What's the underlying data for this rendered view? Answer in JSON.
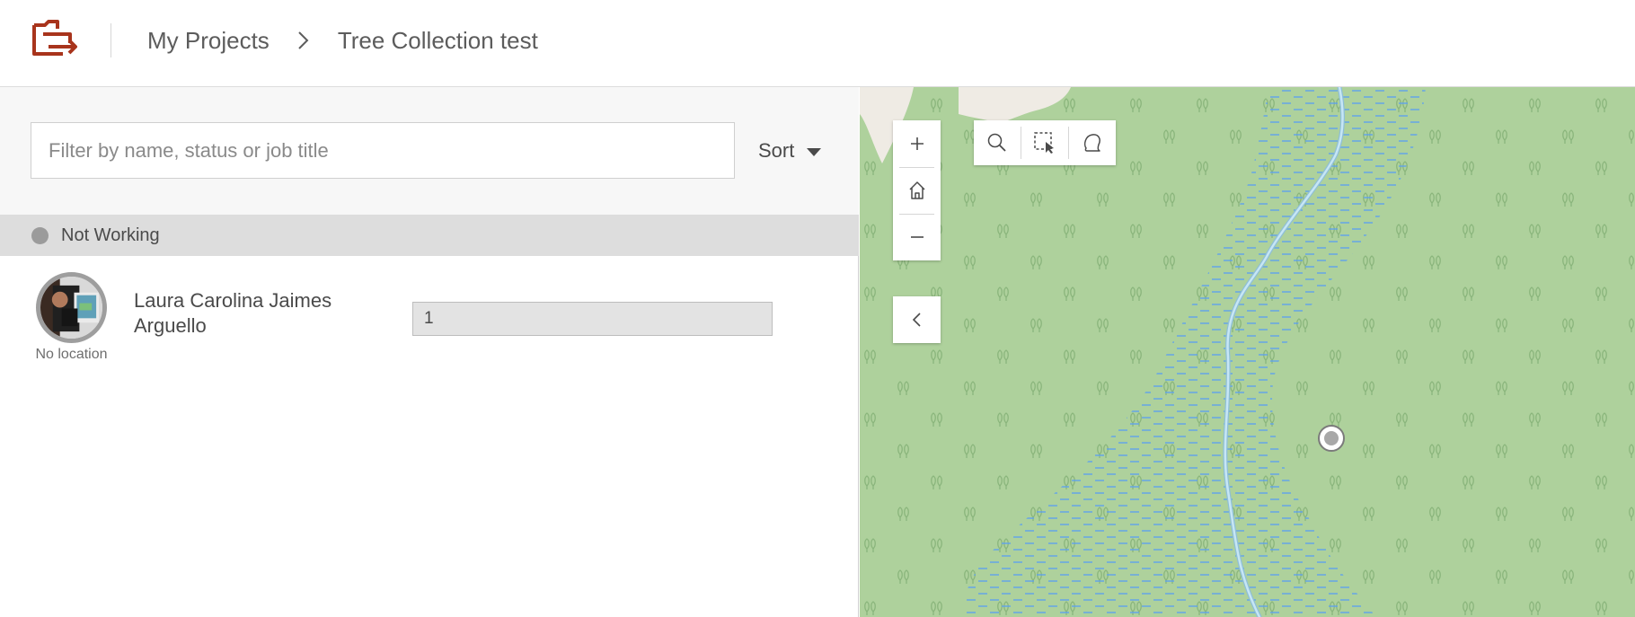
{
  "header": {
    "logo_icon": "folder-arrow-icon",
    "brand_color": "#a8341c",
    "breadcrumb": {
      "parent": "My Projects",
      "current": "Tree Collection test"
    }
  },
  "left_panel": {
    "filter": {
      "placeholder": "Filter by name, status or job title",
      "value": ""
    },
    "sort_label": "Sort",
    "groups": [
      {
        "status": "Not Working",
        "status_color": "#9b9b9b",
        "workers": [
          {
            "name": "Laura Carolina Jaimes Arguello",
            "location": "No location",
            "field_value": "1"
          }
        ]
      }
    ]
  },
  "map": {
    "controls": {
      "zoom_in_icon": "plus-icon",
      "home_icon": "home-icon",
      "zoom_out_icon": "minus-icon",
      "search_icon": "search-icon",
      "select_icon": "rectangle-select-icon",
      "lasso_icon": "lasso-select-icon",
      "collapse_icon": "chevron-left-icon"
    },
    "colors": {
      "forest": "#aed19c",
      "wetland_dash": "#5b9ff0",
      "stream": "#a7d7f2",
      "unclassified": "#efebe4"
    }
  }
}
